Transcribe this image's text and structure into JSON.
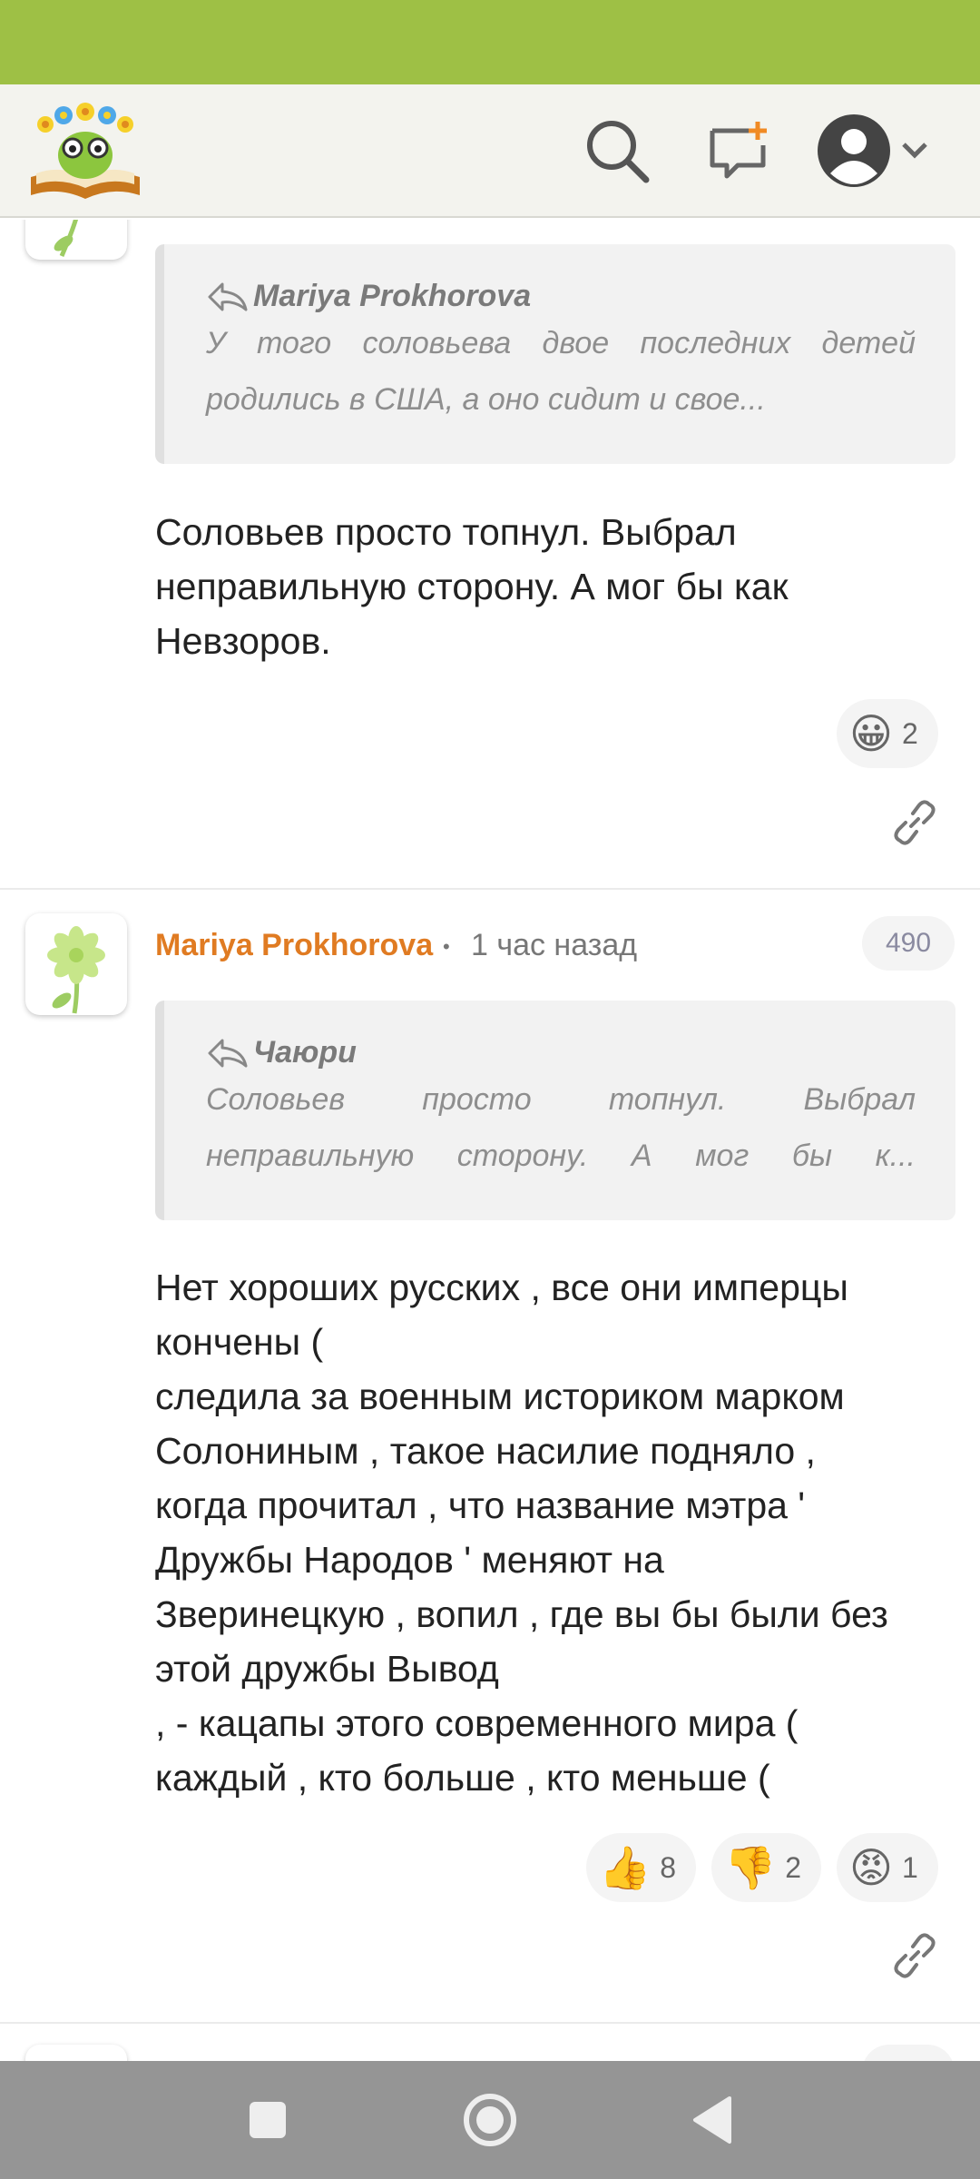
{
  "header": {
    "logo": "book-with-flowers-logo",
    "search_icon": "search-icon",
    "new_post_icon": "add-comment-icon",
    "profile_icon": "user-avatar-icon"
  },
  "comments": [
    {
      "quote": {
        "author": "Mariya Prokhorova",
        "line1": "У того соловьева двое последних детей",
        "line2": "родились в США, а оно сидит и свое..."
      },
      "lines": [
        "Соловьев просто топнул. Выбрал",
        "неправильную сторону. А мог бы как",
        "Невзоров."
      ],
      "reactions": [
        {
          "emoji": "😀",
          "count": "2"
        }
      ]
    },
    {
      "author": "Mariya Prokhorova",
      "separator": "•",
      "time": "1 час назад",
      "score": "490",
      "quote": {
        "author": "Чаюри",
        "line1": "Соловьев просто топнул. Выбрал",
        "line2": "неправильную сторону. А мог бы к..."
      },
      "lines": [
        "Нет хороших русских , все они имперцы",
        "кончены (",
        "следила за военным историком марком",
        "Солониным , такое насилие подняло ,",
        "когда прочитал , что название мэтра '",
        "Дружбы Народов ' меняют на",
        "Зверинецкую , вопил , где вы бы были без",
        "этой дружбы Вывод",
        ", - кацапы этого современного мира (",
        "каждый , кто больше , кто меньше ("
      ],
      "reactions": [
        {
          "emoji": "👍",
          "count": "8"
        },
        {
          "emoji": "👎",
          "count": "2"
        },
        {
          "emoji": "😡",
          "count": "1"
        }
      ]
    }
  ],
  "nav": {
    "recents": "square-icon",
    "home": "circle-icon",
    "back": "triangle-back-icon"
  },
  "colors": {
    "status_bar": "#9ec045",
    "author": "#e07b22",
    "nav_bar": "#959595"
  }
}
